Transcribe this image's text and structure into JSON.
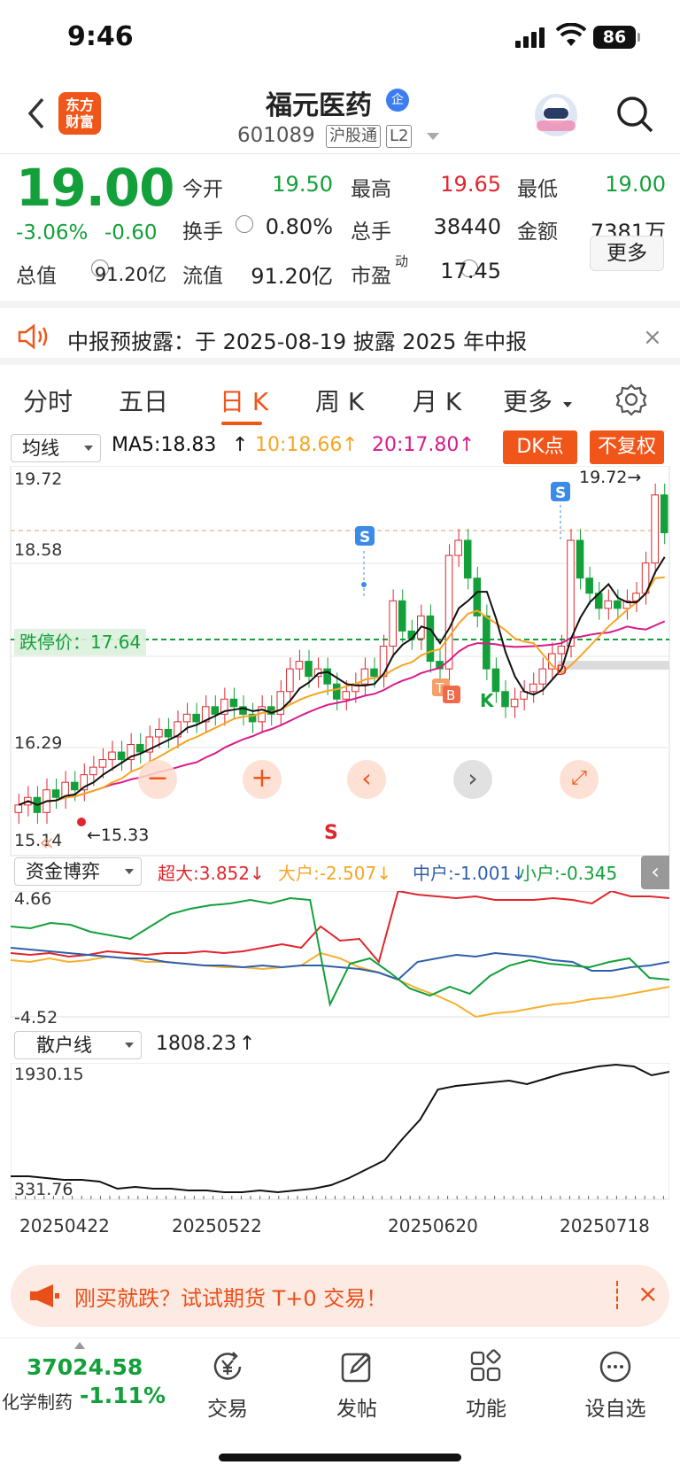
{
  "status": {
    "time": "9:46",
    "battery": "86"
  },
  "header": {
    "logo_line1": "东方",
    "logo_line2": "财富",
    "name": "福元医药",
    "badge": "企",
    "code": "601089",
    "tag1": "沪股通",
    "tag2": "L2"
  },
  "quote": {
    "price": "19.00",
    "change_pct": "-3.06%",
    "change": "-0.60",
    "open_label": "今开",
    "open": "19.50",
    "high_label": "最高",
    "high": "19.65",
    "low_label": "最低",
    "low": "19.00",
    "turnover_label": "换手",
    "turnover": "0.80%",
    "volume_label": "总手",
    "volume": "38440",
    "amount_label": "金额",
    "amount": "7381万",
    "mktcap_label": "总值",
    "mktcap": "91.20亿",
    "float_label": "流值",
    "float": "91.20亿",
    "pe_label": "市盈",
    "pe_sup": "动",
    "pe": "17.45",
    "more": "更多"
  },
  "notice": {
    "text": "中报预披露：于 2025-08-19 披露 2025 年中报",
    "close": "×"
  },
  "tabs": [
    {
      "label": "分时"
    },
    {
      "label": "五日"
    },
    {
      "label": "日 K"
    },
    {
      "label": "周 K"
    },
    {
      "label": "月 K"
    },
    {
      "label": "更多"
    }
  ],
  "kline": {
    "indicator": "均线",
    "ma5": "MA5:18.83",
    "ma10": "10:18.66",
    "ma20": "20:17.80",
    "dk_button": "DK点",
    "fq_button": "不复权",
    "y_top": "19.72",
    "y_mid1": "18.58",
    "y_mid2": "16.29",
    "y_low": "15.14",
    "high_marker": "19.72→",
    "low_marker": "←15.33",
    "limit_down_label": "跌停价：17.64",
    "colors": {
      "ma5": "#111111",
      "ma10": "#f5a623",
      "ma20": "#d81b8a",
      "up": "#e0262c",
      "down": "#13a03a"
    }
  },
  "chart_data": [
    {
      "type": "line",
      "name": "资金博弈",
      "series": [
        {
          "name": "超大",
          "last": "3.852"
        },
        {
          "name": "大户",
          "last": "-2.507"
        },
        {
          "name": "中户",
          "last": "-1.001"
        },
        {
          "name": "小户",
          "last": "-0.345"
        }
      ],
      "ylim": [
        -4.52,
        4.66
      ]
    },
    {
      "type": "line",
      "name": "散户线",
      "last": "1808.23",
      "ylim": [
        331.76,
        1930.15
      ]
    }
  ],
  "fund": {
    "indicator": "资金博弈",
    "super_large": "超大:3.852↓",
    "large": "大户:-2.507↓",
    "medium": "中户:-1.001↓",
    "small": "小户:-0.345",
    "y_top": "4.66",
    "y_bottom": "-4.52"
  },
  "retail": {
    "indicator": "散户线",
    "value": "1808.23",
    "y_top": "1930.15",
    "y_bottom": "331.76",
    "dates": [
      "20250422",
      "20250522",
      "20250620",
      "20250718"
    ]
  },
  "promo": {
    "text": "刚买就跌？试试期货 T+0 交易！",
    "close": "×"
  },
  "bottom": {
    "index_value": "37024.58",
    "index_name": "化学制药",
    "index_pct": "-1.11%",
    "nav": [
      {
        "label": "交易"
      },
      {
        "label": "发帖"
      },
      {
        "label": "功能"
      },
      {
        "label": "设自选"
      }
    ]
  }
}
